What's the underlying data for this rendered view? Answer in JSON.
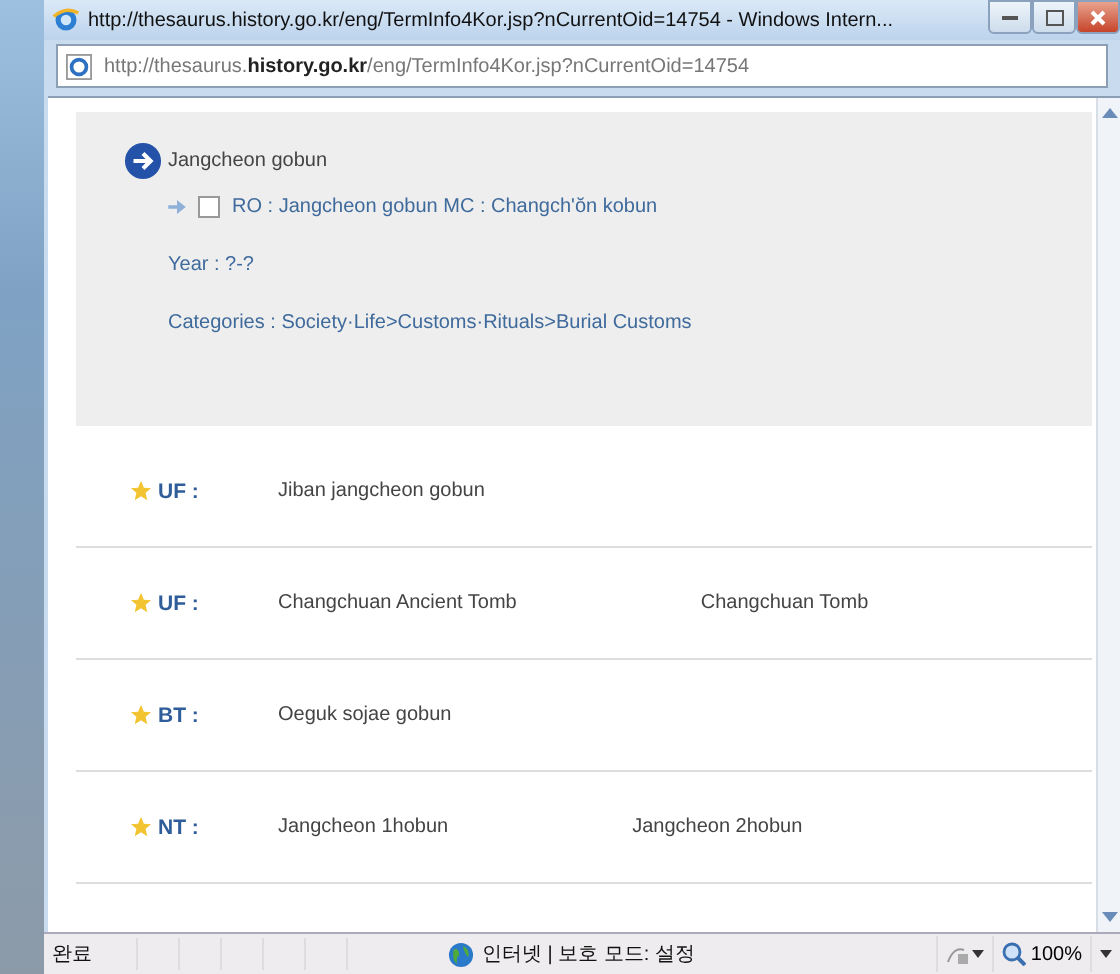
{
  "window": {
    "title": "http://thesaurus.history.go.kr/eng/TermInfo4Kor.jsp?nCurrentOid=14754 - Windows Intern..."
  },
  "address_bar": {
    "url": "http://thesaurus.**history.go.kr**/eng/TermInfo4Kor.jsp?nCurrentOid=14754"
  },
  "term": {
    "title": "Jangcheon gobun",
    "related": "RO : Jangcheon gobun MC : Changch'ŏn kobun",
    "related_checked": false,
    "year": "Year : ?-?",
    "categories": "Categories : Society·Life>Customs·Rituals>Burial Customs"
  },
  "relations": [
    {
      "label": "UF :",
      "values": [
        "Jiban jangcheon gobun"
      ]
    },
    {
      "label": "UF :",
      "values": [
        "Changchuan Ancient Tomb",
        "Changchuan Tomb"
      ]
    },
    {
      "label": "BT :",
      "values": [
        "Oeguk sojae gobun"
      ]
    },
    {
      "label": "NT :",
      "values": [
        "Jangcheon 1hobun",
        "Jangcheon 2hobun"
      ]
    }
  ],
  "status_bar": {
    "status": "완료",
    "zone": "인터넷 | 보호 모드: 설정",
    "zoom": "100%"
  }
}
